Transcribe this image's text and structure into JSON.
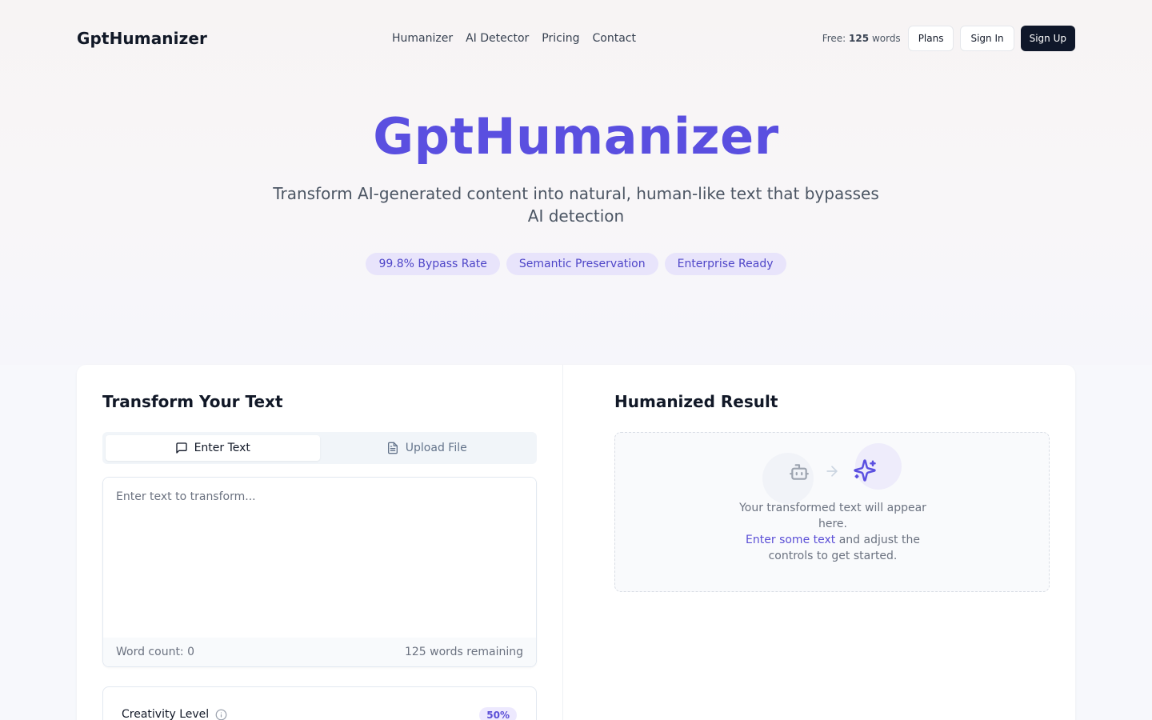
{
  "header": {
    "logo": "GptHumanizer",
    "nav": [
      "Humanizer",
      "AI Detector",
      "Pricing",
      "Contact"
    ],
    "free_label": "Free:",
    "free_count": "125",
    "free_unit": "words",
    "plans": "Plans",
    "sign_in": "Sign In",
    "sign_up": "Sign Up"
  },
  "hero": {
    "title": "GptHumanizer",
    "subtitle": "Transform AI-generated content into natural, human-like text that bypasses AI detection",
    "badges": [
      "99.8% Bypass Rate",
      "Semantic Preservation",
      "Enterprise Ready"
    ]
  },
  "input_panel": {
    "title": "Transform Your Text",
    "tabs": [
      "Enter Text",
      "Upload File"
    ],
    "active_tab": "Enter Text",
    "placeholder": "Enter text to transform...",
    "value": "",
    "word_count": "Word count: 0",
    "remaining": "125 words remaining",
    "creativity_label": "Creativity Level",
    "creativity_value": "50%"
  },
  "result_panel": {
    "title": "Humanized Result",
    "message_line1": "Your transformed text will appear here.",
    "message_link": "Enter some text",
    "message_line2": " and adjust the controls to get started."
  },
  "colors": {
    "accent": "#5a4fe0",
    "badge_bg": "#e8e4fb",
    "dark_button": "#0f172a"
  }
}
